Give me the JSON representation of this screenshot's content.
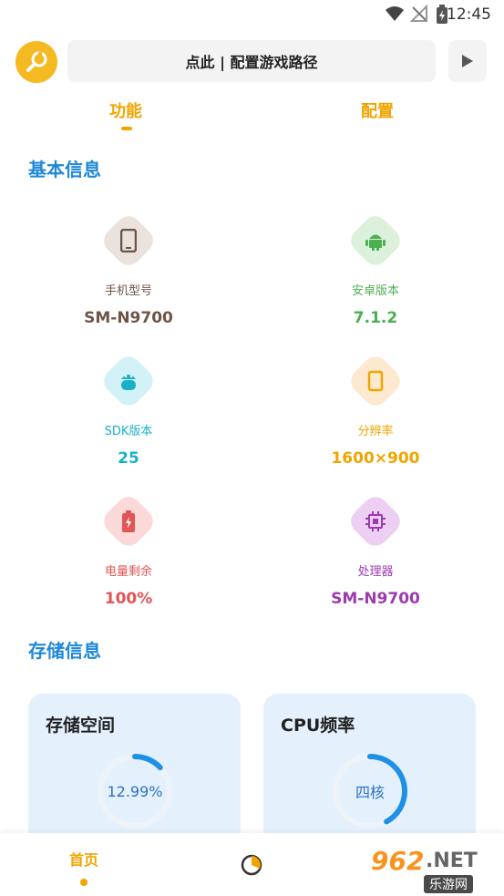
{
  "status_bar": {
    "time": "12:45"
  },
  "header": {
    "path_label": "点此 | 配置游戏路径"
  },
  "tabs": [
    {
      "label": "功能",
      "active": true
    },
    {
      "label": "配置",
      "active": false
    }
  ],
  "basic_info": {
    "title": "基本信息",
    "items": [
      {
        "label": "手机型号",
        "value": "SM-N9700",
        "color": "#6d5548",
        "bg": "#e9e2dd",
        "icon": "phone-icon"
      },
      {
        "label": "安卓版本",
        "value": "7.1.2",
        "color": "#4caf50",
        "bg": "#dcf0dc",
        "icon": "android-icon"
      },
      {
        "label": "SDK版本",
        "value": "25",
        "color": "#1ab0c8",
        "bg": "#d3f2f7",
        "icon": "android-head-icon"
      },
      {
        "label": "分辨率",
        "value": "1600×900",
        "color": "#f0a500",
        "bg": "#fde9cf",
        "icon": "screen-icon"
      },
      {
        "label": "电量剩余",
        "value": "100%",
        "color": "#e05555",
        "bg": "#fbd9d9",
        "icon": "battery-icon"
      },
      {
        "label": "处理器",
        "value": "SM-N9700",
        "color": "#9c3bb0",
        "bg": "#eccff2",
        "icon": "chip-icon"
      }
    ]
  },
  "storage_info": {
    "title": "存储信息",
    "cards": [
      {
        "title": "存储空间",
        "gauge_text": "12.99%",
        "fraction": 0.13
      },
      {
        "title": "CPU频率",
        "gauge_text": "四核",
        "fraction": 0.42
      }
    ]
  },
  "bottom_nav": {
    "home_label": "首页"
  },
  "watermark": {
    "number": "962",
    "domain": ".NET",
    "sub": "乐游网"
  }
}
